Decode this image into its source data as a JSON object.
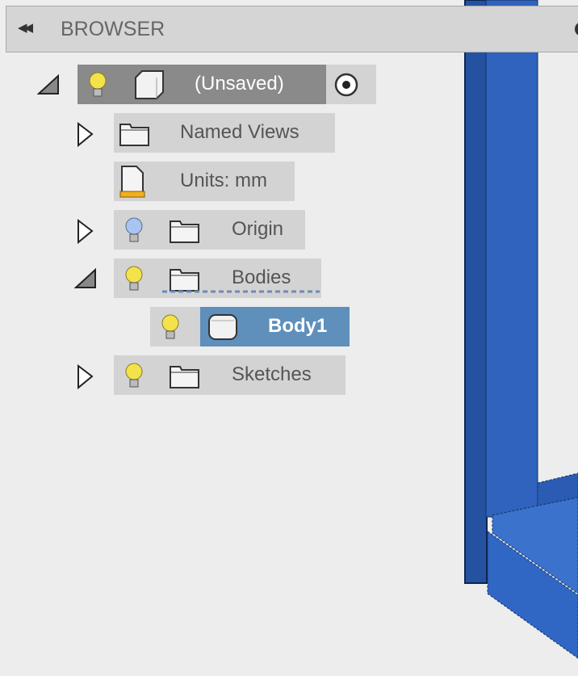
{
  "browser": {
    "title": "BROWSER",
    "collapse_icon": "double-chevron-left-icon",
    "pin_icon": "pin-icon"
  },
  "tree": {
    "root": {
      "label": "(Unsaved)",
      "expanded": true
    },
    "named_views": {
      "label": "Named Views",
      "expanded": false
    },
    "units": {
      "label": "Units: mm"
    },
    "origin": {
      "label": "Origin",
      "expanded": false
    },
    "bodies": {
      "label": "Bodies",
      "expanded": true
    },
    "body1": {
      "label": "Body1",
      "selected": true
    },
    "sketches": {
      "label": "Sketches",
      "expanded": false
    }
  },
  "colors": {
    "selection": "#5f8fbb",
    "model": "#2e63bf",
    "bulb_on": "#f4e24a",
    "bulb_off": "#a8c4f0"
  }
}
